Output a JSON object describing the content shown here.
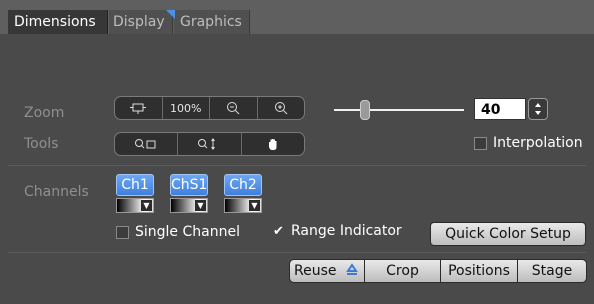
{
  "tabs": [
    {
      "label": "Dimensions",
      "active": true
    },
    {
      "label": "Display",
      "active": false
    },
    {
      "label": "Graphics",
      "active": false
    }
  ],
  "zoom": {
    "label": "Zoom",
    "buttons": [
      {
        "icon": "fit-to-window-icon"
      },
      {
        "label": "100%"
      },
      {
        "icon": "zoom-out-icon"
      },
      {
        "icon": "zoom-in-icon"
      }
    ],
    "slider_value": 40,
    "value": "40"
  },
  "tools": {
    "label": "Tools",
    "buttons": [
      {
        "icon": "zoom-select-rect-icon"
      },
      {
        "icon": "zoom-vertical-icon"
      },
      {
        "icon": "pan-hand-icon"
      }
    ],
    "interpolation_label": "Interpolation",
    "interpolation_checked": false
  },
  "channels": {
    "label": "Channels",
    "items": [
      {
        "label": "Ch1"
      },
      {
        "label": "ChS1"
      },
      {
        "label": "Ch2"
      }
    ],
    "single_channel_label": "Single Channel",
    "single_channel_checked": false,
    "range_indicator_label": "Range Indicator",
    "range_indicator_checked": true,
    "quick_color_label": "Quick Color Setup"
  },
  "bottom": {
    "reuse_label": "Reuse",
    "crop_label": "Crop",
    "positions_label": "Positions",
    "stage_label": "Stage"
  },
  "colors": {
    "accent": "#4a86e0",
    "panel": "#4a4a4a"
  }
}
